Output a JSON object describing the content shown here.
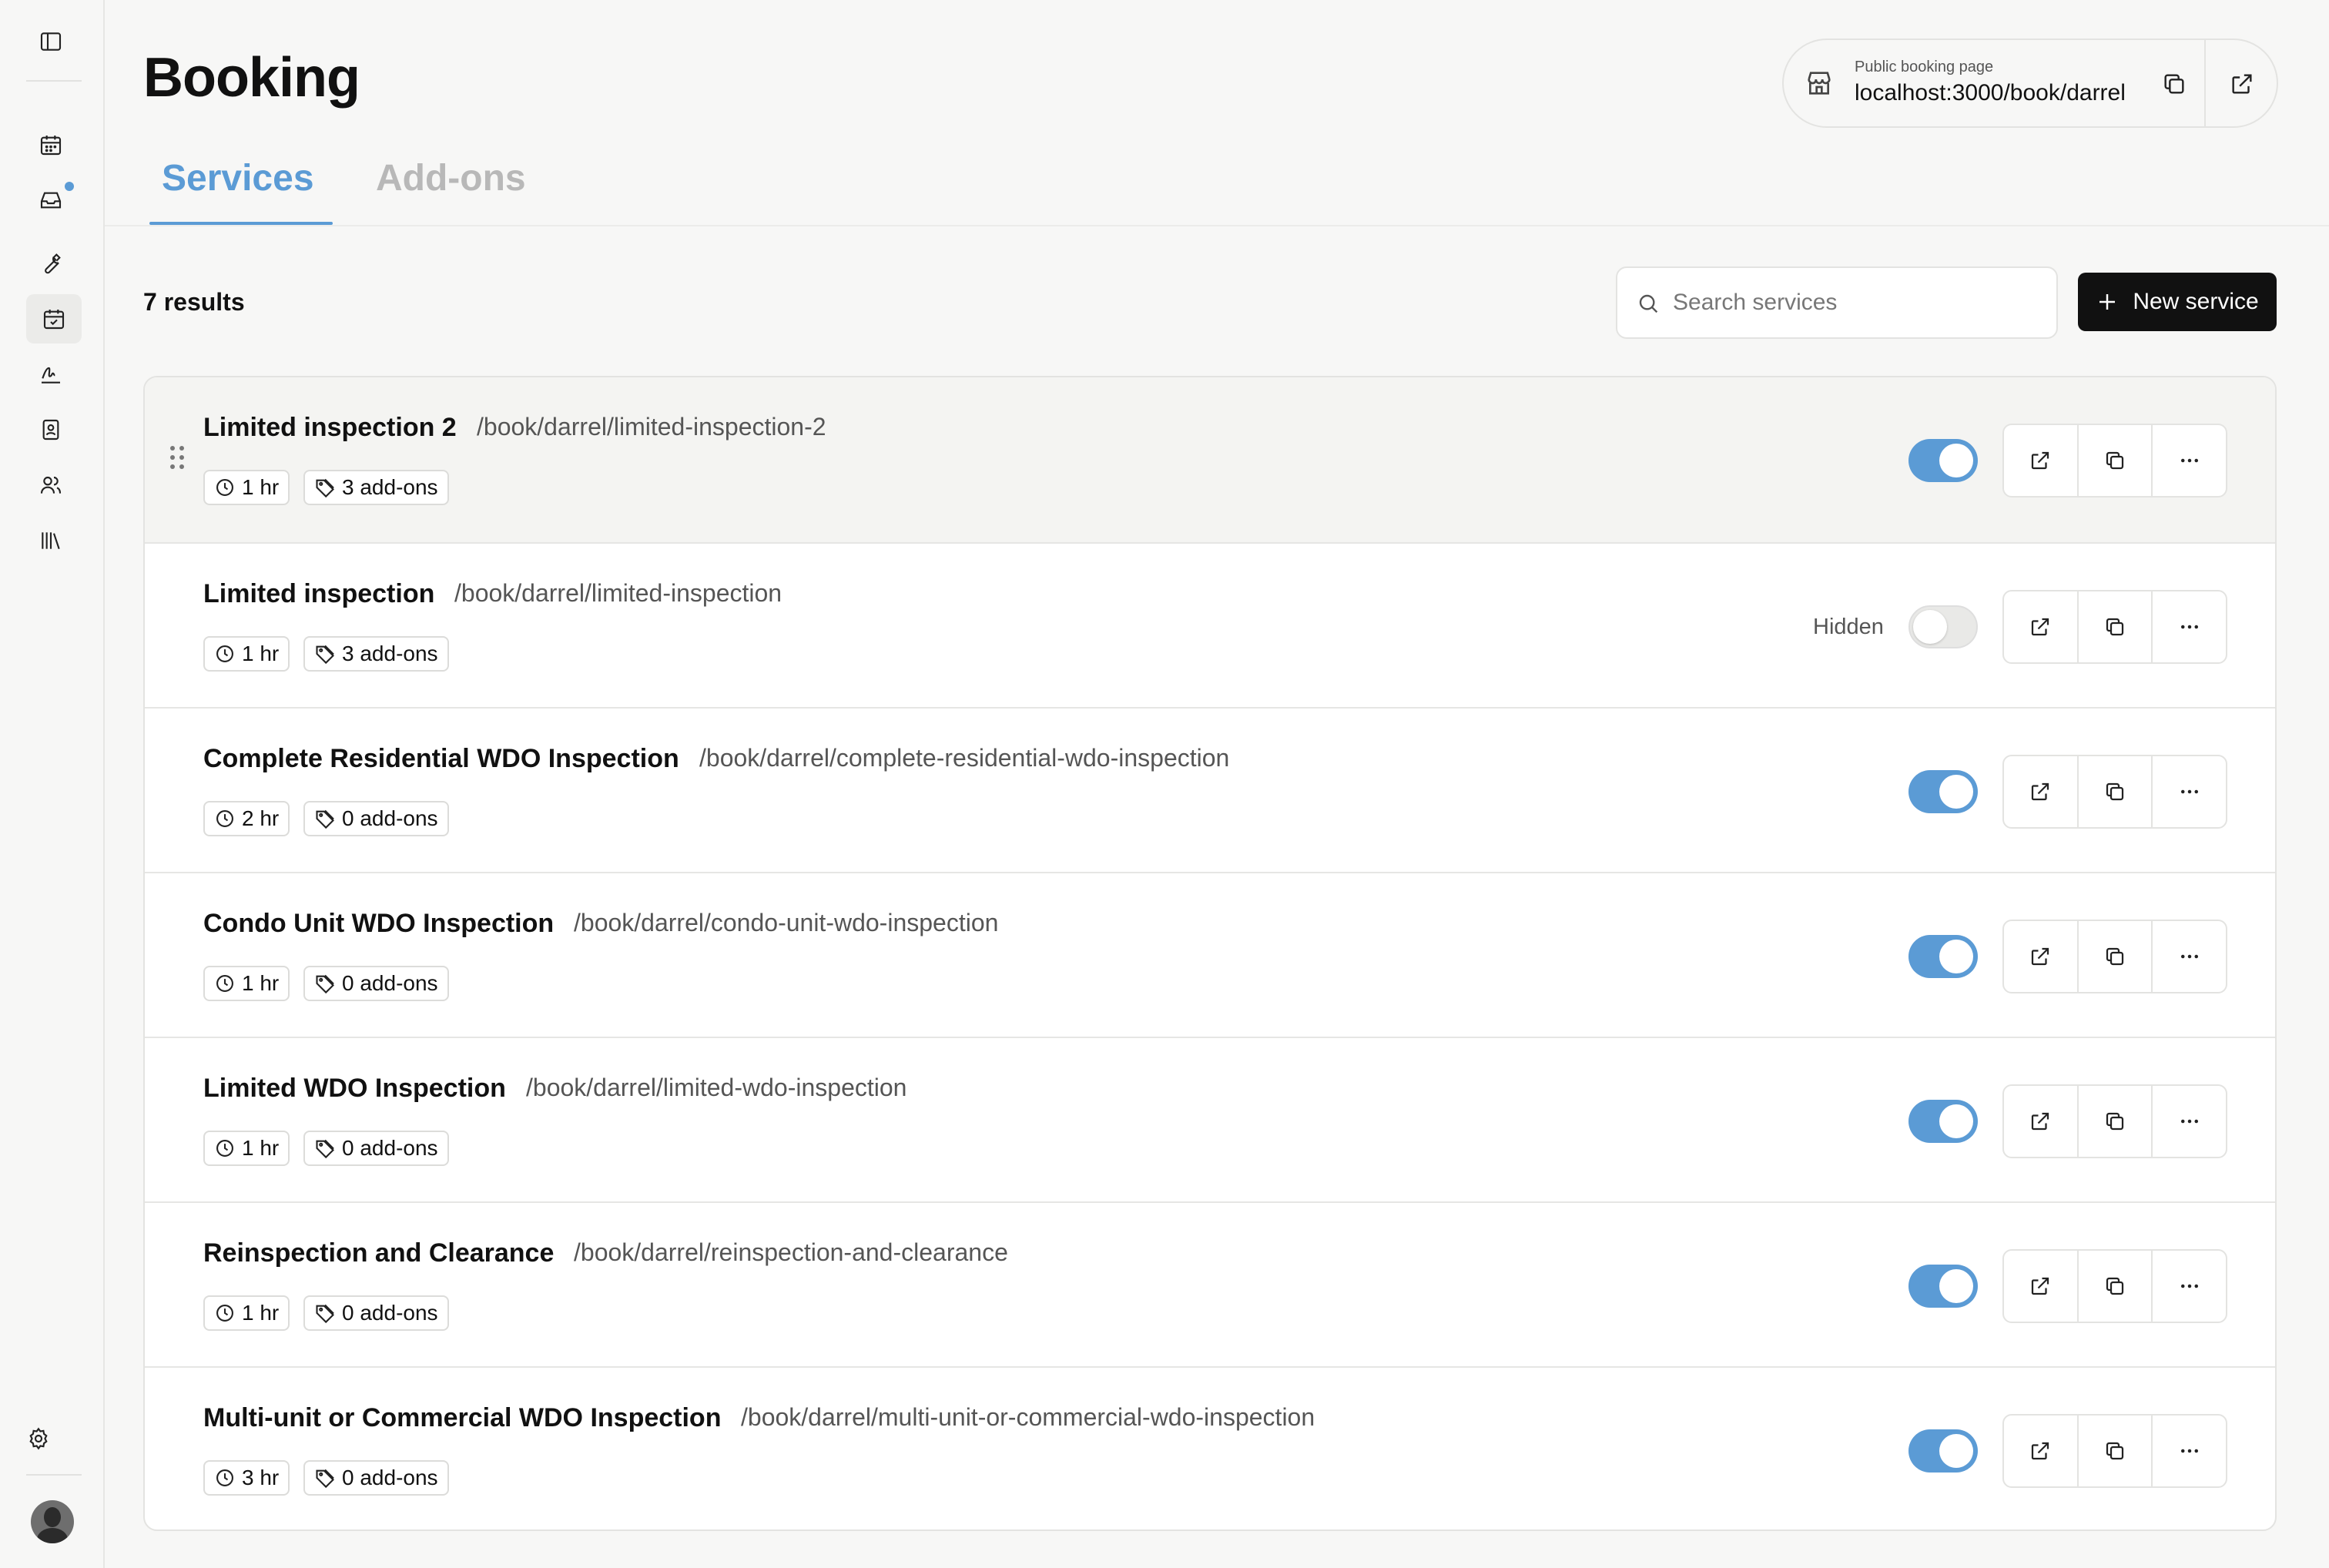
{
  "page": {
    "title": "Booking"
  },
  "tabs": [
    {
      "label": "Services",
      "active": true
    },
    {
      "label": "Add-ons",
      "active": false
    }
  ],
  "public_booking": {
    "label": "Public booking page",
    "url": "localhost:3000/book/darrel"
  },
  "toolbar": {
    "results": "7 results",
    "search_placeholder": "Search services",
    "new_label": "New service"
  },
  "hidden_label": "Hidden",
  "services": [
    {
      "name": "Limited inspection 2",
      "path": "/book/darrel/limited-inspection-2",
      "duration": "1 hr",
      "addons": "3 add-ons",
      "enabled": true
    },
    {
      "name": "Limited inspection",
      "path": "/book/darrel/limited-inspection",
      "duration": "1 hr",
      "addons": "3 add-ons",
      "enabled": false
    },
    {
      "name": "Complete Residential WDO Inspection",
      "path": "/book/darrel/complete-residential-wdo-inspection",
      "duration": "2 hr",
      "addons": "0 add-ons",
      "enabled": true
    },
    {
      "name": "Condo Unit WDO Inspection",
      "path": "/book/darrel/condo-unit-wdo-inspection",
      "duration": "1 hr",
      "addons": "0 add-ons",
      "enabled": true
    },
    {
      "name": "Limited WDO Inspection",
      "path": "/book/darrel/limited-wdo-inspection",
      "duration": "1 hr",
      "addons": "0 add-ons",
      "enabled": true
    },
    {
      "name": "Reinspection and Clearance",
      "path": "/book/darrel/reinspection-and-clearance",
      "duration": "1 hr",
      "addons": "0 add-ons",
      "enabled": true
    },
    {
      "name": "Multi-unit or Commercial WDO Inspection",
      "path": "/book/darrel/multi-unit-or-commercial-wdo-inspection",
      "duration": "3 hr",
      "addons": "0 add-ons",
      "enabled": true
    }
  ],
  "colors": {
    "accent": "#5b9bd5",
    "primary_button": "#111111"
  }
}
